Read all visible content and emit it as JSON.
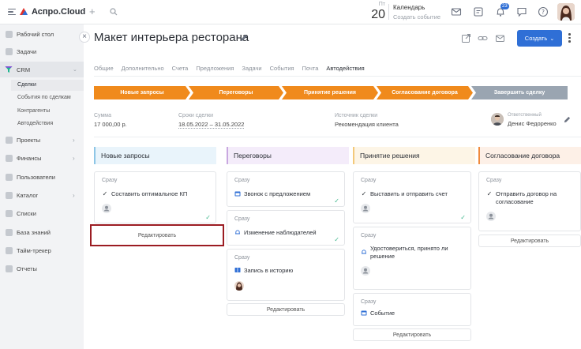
{
  "topbar": {
    "logo": "Аспро.Cloud",
    "calendar": {
      "dow": "Пт",
      "day": "20",
      "title": "Календарь",
      "subtitle": "Создать событие"
    },
    "notif_count": "23"
  },
  "sidebar": {
    "items": [
      {
        "label": "Рабочий стол",
        "icon": "desktop-icon",
        "chevron": false
      },
      {
        "label": "Задачи",
        "icon": "tasks-icon",
        "chevron": false
      },
      {
        "label": "CRM",
        "icon": "crm-funnel-icon",
        "chevron": true,
        "active": true
      },
      {
        "label": "Проекты",
        "icon": "projects-icon",
        "chevron": true
      },
      {
        "label": "Финансы",
        "icon": "finance-icon",
        "chevron": true
      },
      {
        "label": "Пользователи",
        "icon": "users-icon",
        "chevron": false
      },
      {
        "label": "Каталог",
        "icon": "catalog-icon",
        "chevron": true
      },
      {
        "label": "Списки",
        "icon": "lists-icon",
        "chevron": false
      },
      {
        "label": "База знаний",
        "icon": "knowledge-icon",
        "chevron": false
      },
      {
        "label": "Тайм-трекер",
        "icon": "timer-icon",
        "chevron": false
      },
      {
        "label": "Отчеты",
        "icon": "reports-icon",
        "chevron": false
      }
    ],
    "crm_sub": [
      "Сделки",
      "События по сделкам",
      "Контрагенты",
      "Автодействия"
    ]
  },
  "deal": {
    "title": "Макет интерьера ресторана",
    "create_label": "Создать",
    "tabs": [
      "Общие",
      "Дополнительно",
      "Счета",
      "Предложения",
      "Задачи",
      "События",
      "Почта",
      "Автодействия"
    ],
    "active_tab": 7,
    "stages": [
      {
        "label": "Новые запросы",
        "color": "#f08a1c"
      },
      {
        "label": "Переговоры",
        "color": "#f08a1c"
      },
      {
        "label": "Принятие решения",
        "color": "#f08a1c"
      },
      {
        "label": "Согласование договора",
        "color": "#f08a1c"
      },
      {
        "label": "Завершить сделку",
        "color": "#9aa5b1"
      }
    ],
    "info": {
      "sum_label": "Сумма",
      "sum_value": "17 000,00 р.",
      "dates_label": "Сроки сделки",
      "dates_value": "18.05.2022 – 31.05.2022",
      "source_label": "Источник сделки",
      "source_value": "Рекомендация клиента",
      "resp_label": "Ответственный",
      "resp_value": "Денис Федоренко"
    }
  },
  "columns": [
    {
      "title": "Новые запросы",
      "color": "#8ec6e6",
      "bg": "#e9f4fb",
      "cards": [
        {
          "when": "Сразу",
          "icon": "checkmark-icon",
          "action": "Составить оптимальное КП",
          "done": true
        }
      ],
      "edit": "Редактировать"
    },
    {
      "title": "Переговоры",
      "color": "#c9a8e0",
      "bg": "#f4ecfa",
      "cards": [
        {
          "when": "Сразу",
          "icon": "calendar-icon",
          "action": "Звонок с предложением",
          "done": true
        },
        {
          "when": "Сразу",
          "icon": "bell-icon",
          "action": "Изменение наблюдателей",
          "done": true
        },
        {
          "when": "Сразу",
          "icon": "book-icon",
          "action": "Запись в историю",
          "done": false
        }
      ],
      "edit": "Редактировать"
    },
    {
      "title": "Принятие решения",
      "color": "#f3c97a",
      "bg": "#fdf5e6",
      "cards": [
        {
          "when": "Сразу",
          "icon": "checkmark-icon",
          "action": "Выставить и отправить счет",
          "done": true
        },
        {
          "when": "Сразу",
          "icon": "bell-icon",
          "action": "Удостовериться, принято ли решение",
          "done": false
        },
        {
          "when": "Сразу",
          "icon": "calendar-icon",
          "action": "Событие",
          "done": false
        }
      ],
      "edit": "Редактировать"
    },
    {
      "title": "Согласование договора",
      "color": "#f08a3c",
      "bg": "#fdf0e7",
      "cards": [
        {
          "when": "Сразу",
          "icon": "checkmark-icon",
          "action": "Отправить договор на согласование",
          "done": false
        }
      ],
      "edit": "Редактировать"
    }
  ]
}
